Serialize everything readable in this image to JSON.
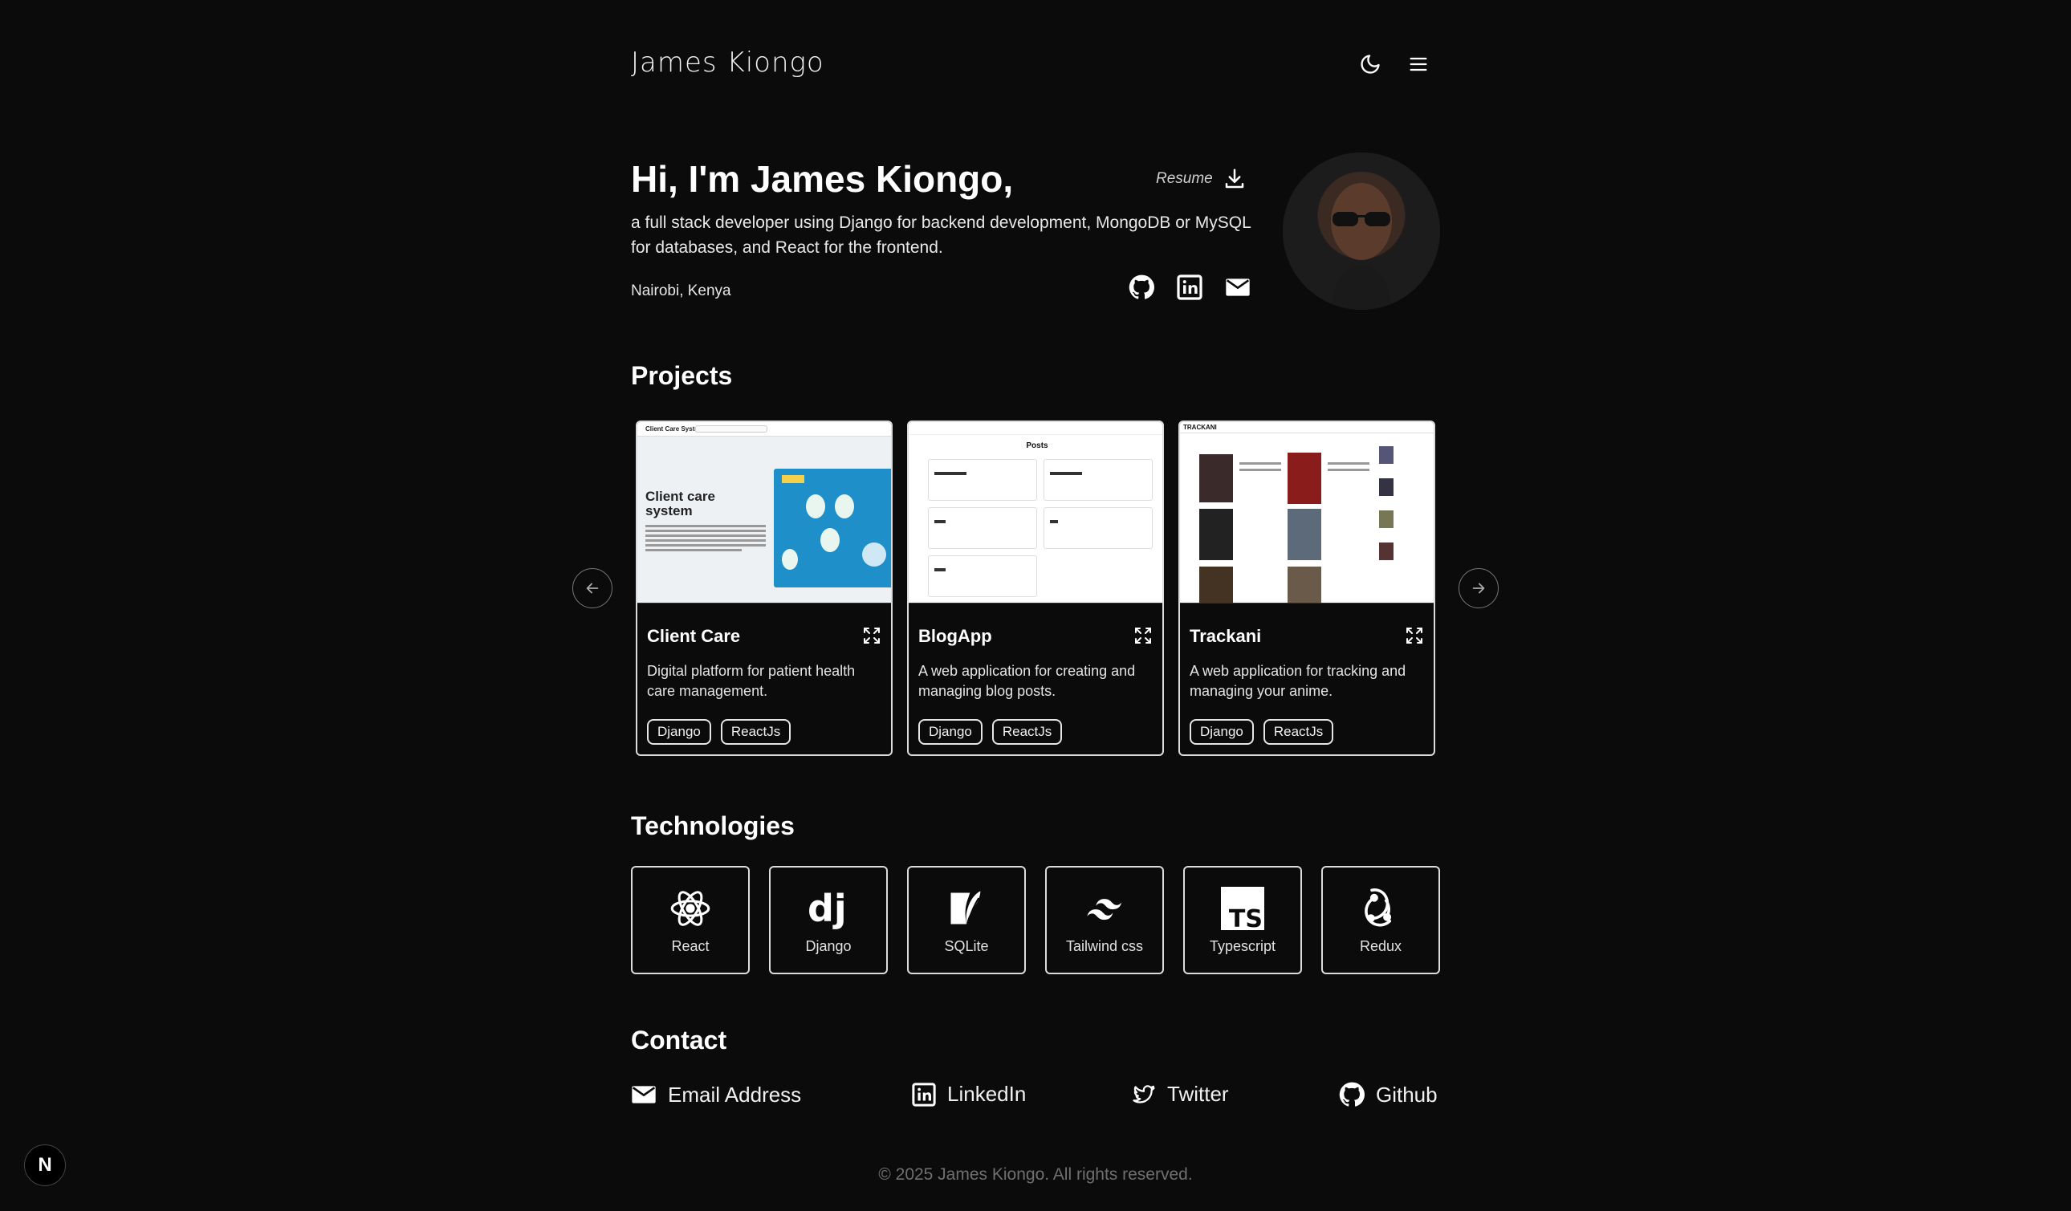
{
  "header": {
    "brand": "James Kiongo"
  },
  "hero": {
    "title": "Hi, I'm James Kiongo,",
    "description": "a full stack developer using Django for backend development, MongoDB or MySQL for databases, and React for the frontend.",
    "location": "Nairobi, Kenya",
    "resume_label": "Resume"
  },
  "projects": {
    "title": "Projects",
    "items": [
      {
        "title": "Client Care",
        "description": "Digital platform for patient health care management.",
        "tags": [
          "Django",
          "ReactJs"
        ],
        "thumb_heading": "Client care system",
        "thumb_brand": "Client Care System"
      },
      {
        "title": "BlogApp",
        "description": "A web application for creating and managing blog posts.",
        "tags": [
          "Django",
          "ReactJs"
        ],
        "thumb_heading": "Posts"
      },
      {
        "title": "Trackani",
        "description": "A web application for tracking and managing your anime.",
        "tags": [
          "Django",
          "ReactJs"
        ],
        "thumb_brand": "TRACKANI"
      }
    ]
  },
  "technologies": {
    "title": "Technologies",
    "items": [
      {
        "label": "React",
        "icon": "react-icon"
      },
      {
        "label": "Django",
        "icon": "django-icon"
      },
      {
        "label": "SQLite",
        "icon": "sqlite-icon"
      },
      {
        "label": "Tailwind css",
        "icon": "tailwind-icon"
      },
      {
        "label": "Typescript",
        "icon": "typescript-icon"
      },
      {
        "label": "Redux",
        "icon": "redux-icon"
      }
    ]
  },
  "contact": {
    "title": "Contact",
    "links": [
      {
        "label": "Email Address",
        "icon": "mail-icon"
      },
      {
        "label": "LinkedIn",
        "icon": "linkedin-icon"
      },
      {
        "label": "Twitter",
        "icon": "twitter-icon"
      },
      {
        "label": "Github",
        "icon": "github-icon"
      }
    ]
  },
  "footer": {
    "text": "© 2025 James Kiongo. All rights reserved."
  },
  "next_badge": "N",
  "colors": {
    "background": "#0b0b0b",
    "text": "#ffffff",
    "muted": "#6f6f6f",
    "border": "#dcdcdc"
  }
}
